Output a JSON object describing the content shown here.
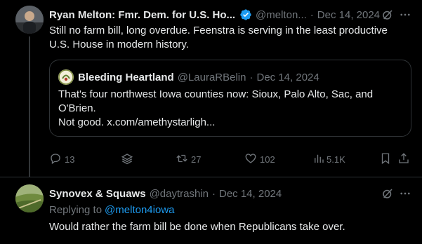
{
  "post": {
    "author_name": "Ryan Melton: Fmr. Dem. for U.S. Ho...",
    "handle": "@melton...",
    "dot": "·",
    "date": "Dec 14, 2024",
    "text": "Still no farm bill, long overdue.  Feenstra is serving in the least productive U.S. House in modern history.",
    "quote": {
      "author_name": "Bleeding Heartland",
      "handle": "@LauraRBelin",
      "dot": "·",
      "date": "Dec 14, 2024",
      "text_line1": "That's four northwest Iowa counties now: Sioux, Palo Alto, Sac, and",
      "text_line2": "O'Brien.",
      "text_line3": "Not good. x.com/amethystarligh..."
    },
    "actions": {
      "replies": "13",
      "retweets": "27",
      "likes": "102",
      "views": "5.1K"
    }
  },
  "reply": {
    "author_name": "Synovex & Squaws",
    "handle": "@daytrashin",
    "dot": "·",
    "date": "Dec 14, 2024",
    "replying_prefix": "Replying to",
    "replying_handle": "@melton4iowa",
    "text": "Would rather the farm bill be done when Republicans take over."
  },
  "colors": {
    "background": "#000000",
    "text": "#e7e9ea",
    "muted": "#71767b",
    "accent": "#1d9bf0",
    "verified": "#1d9bf0",
    "border": "#2f3336"
  },
  "icons": [
    "verified-badge-icon",
    "grok-icon",
    "more-icon",
    "reply-icon",
    "layers-icon",
    "retweet-icon",
    "like-icon",
    "views-icon",
    "bookmark-icon",
    "share-icon"
  ]
}
